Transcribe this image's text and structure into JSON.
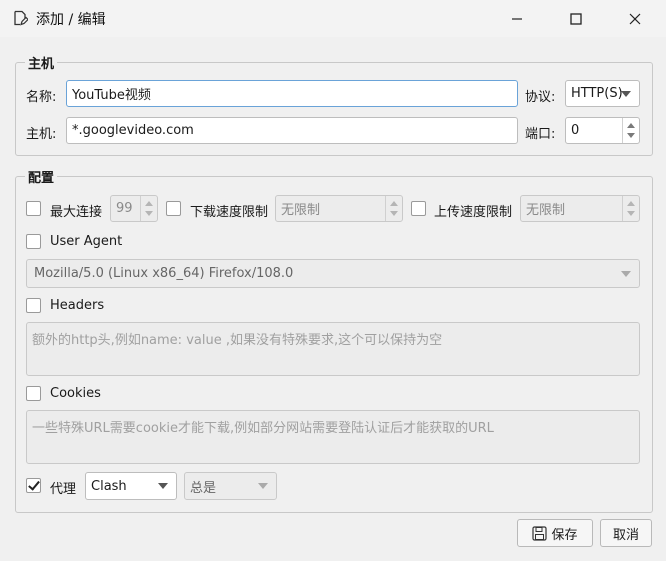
{
  "window": {
    "title": "添加 / 编辑",
    "icons": {
      "app": "edit-document-icon",
      "minimize": "minimize-icon",
      "maximize": "maximize-icon",
      "close": "close-icon"
    }
  },
  "host_group": {
    "title": "主机",
    "name_label": "名称:",
    "name_value": "YouTube视频",
    "host_label": "主机:",
    "host_value": "*.googlevideo.com",
    "protocol_label": "协议:",
    "protocol_value": "HTTP(S)",
    "port_label": "端口:",
    "port_value": "0"
  },
  "config_group": {
    "title": "配置",
    "max_conn_label": "最大连接",
    "max_conn_value": "99",
    "max_conn_checked": false,
    "download_limit_label": "下载速度限制",
    "download_limit_value": "无限制",
    "download_limit_checked": false,
    "upload_limit_label": "上传速度限制",
    "upload_limit_value": "无限制",
    "upload_limit_checked": false,
    "user_agent_label": "User Agent",
    "user_agent_checked": false,
    "user_agent_value": "Mozilla/5.0 (Linux x86_64) Firefox/108.0",
    "headers_label": "Headers",
    "headers_checked": false,
    "headers_placeholder": "额外的http头,例如name: value ,如果没有特殊要求,这个可以保持为空",
    "cookies_label": "Cookies",
    "cookies_checked": false,
    "cookies_placeholder": "一些特殊URL需要cookie才能下载,例如部分网站需要登陆认证后才能获取的URL",
    "proxy_label": "代理",
    "proxy_checked": true,
    "proxy_value": "Clash",
    "proxy_mode_value": "总是"
  },
  "buttons": {
    "save_label": "保存",
    "save_icon": "floppy-disk-icon",
    "cancel_label": "取消"
  }
}
